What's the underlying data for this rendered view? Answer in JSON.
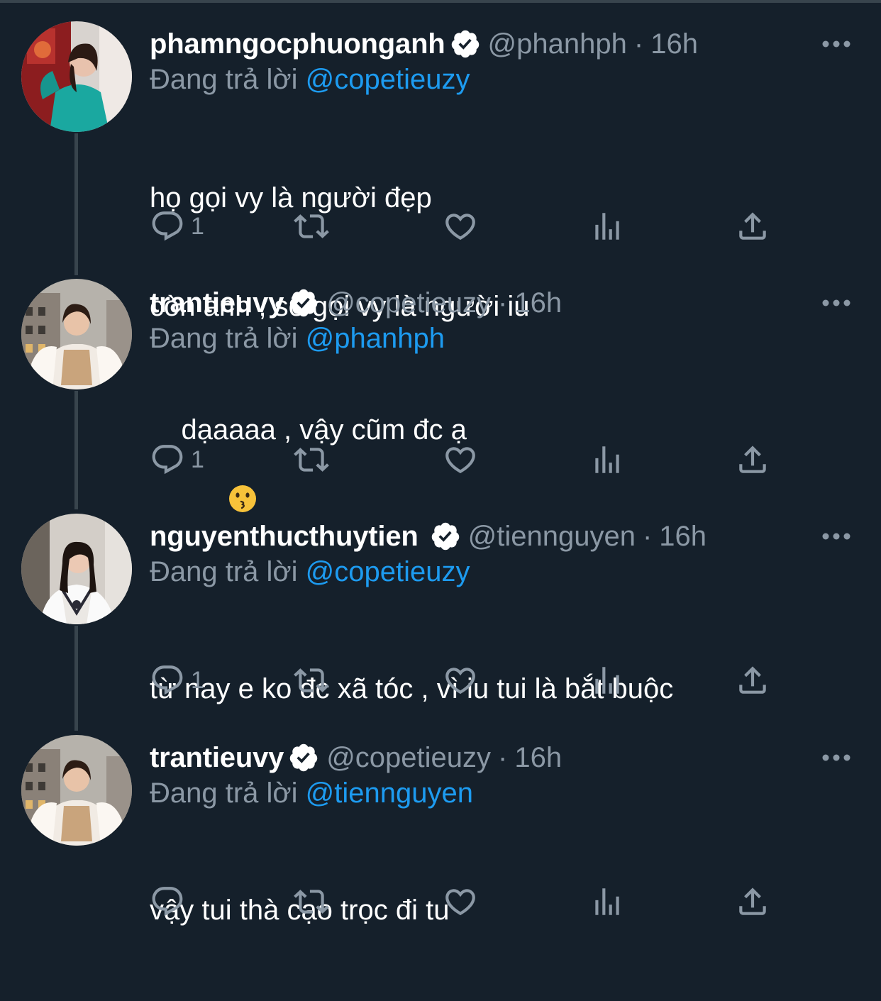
{
  "colors": {
    "background": "#15202b",
    "text": "#ffffff",
    "secondary": "#8b98a5",
    "link": "#1d9bf0",
    "thread_line": "#38444d"
  },
  "icons": {
    "reply": "reply-icon",
    "retweet": "retweet-icon",
    "like": "heart-icon",
    "views": "analytics-icon",
    "share": "share-icon",
    "more": "more-dots-icon",
    "verified": "verified-badge-icon"
  },
  "tweets": [
    {
      "name": "phamngocphuonganh",
      "handle": "@phanhph",
      "separator": "·",
      "time": "16h",
      "reply_prefix": "Đang trả lời",
      "reply_to": "@copetieuzy",
      "lines": [
        "họ gọi vy là người đẹp",
        "còn anh , sẽ gọi vy là người iu"
      ],
      "reply_count": "1"
    },
    {
      "name": "trantieuvy",
      "handle": "@copetieuzy",
      "separator": "·",
      "time": "16h",
      "reply_prefix": "Đang trả lời",
      "reply_to": "@phanhph",
      "lines": [
        "dạaaaa , vậy cũm đc ạ"
      ],
      "emoji": "kissing-face",
      "reply_count": "1"
    },
    {
      "name": "nguyenthucthuytien",
      "handle": "@tiennguyen",
      "separator": "·",
      "time": "16h",
      "reply_prefix": "Đang trả lời",
      "reply_to": "@copetieuzy",
      "lines": [
        "từ nay e ko đc xã tóc , vì iu tui là bắt buộc"
      ],
      "reply_count": "1"
    },
    {
      "name": "trantieuvy",
      "handle": "@copetieuzy",
      "separator": "·",
      "time": "16h",
      "reply_prefix": "Đang trả lời",
      "reply_to": "@tiennguyen",
      "lines": [
        "vậy tui thà cạo trọc đi tu"
      ],
      "reply_count": ""
    }
  ]
}
